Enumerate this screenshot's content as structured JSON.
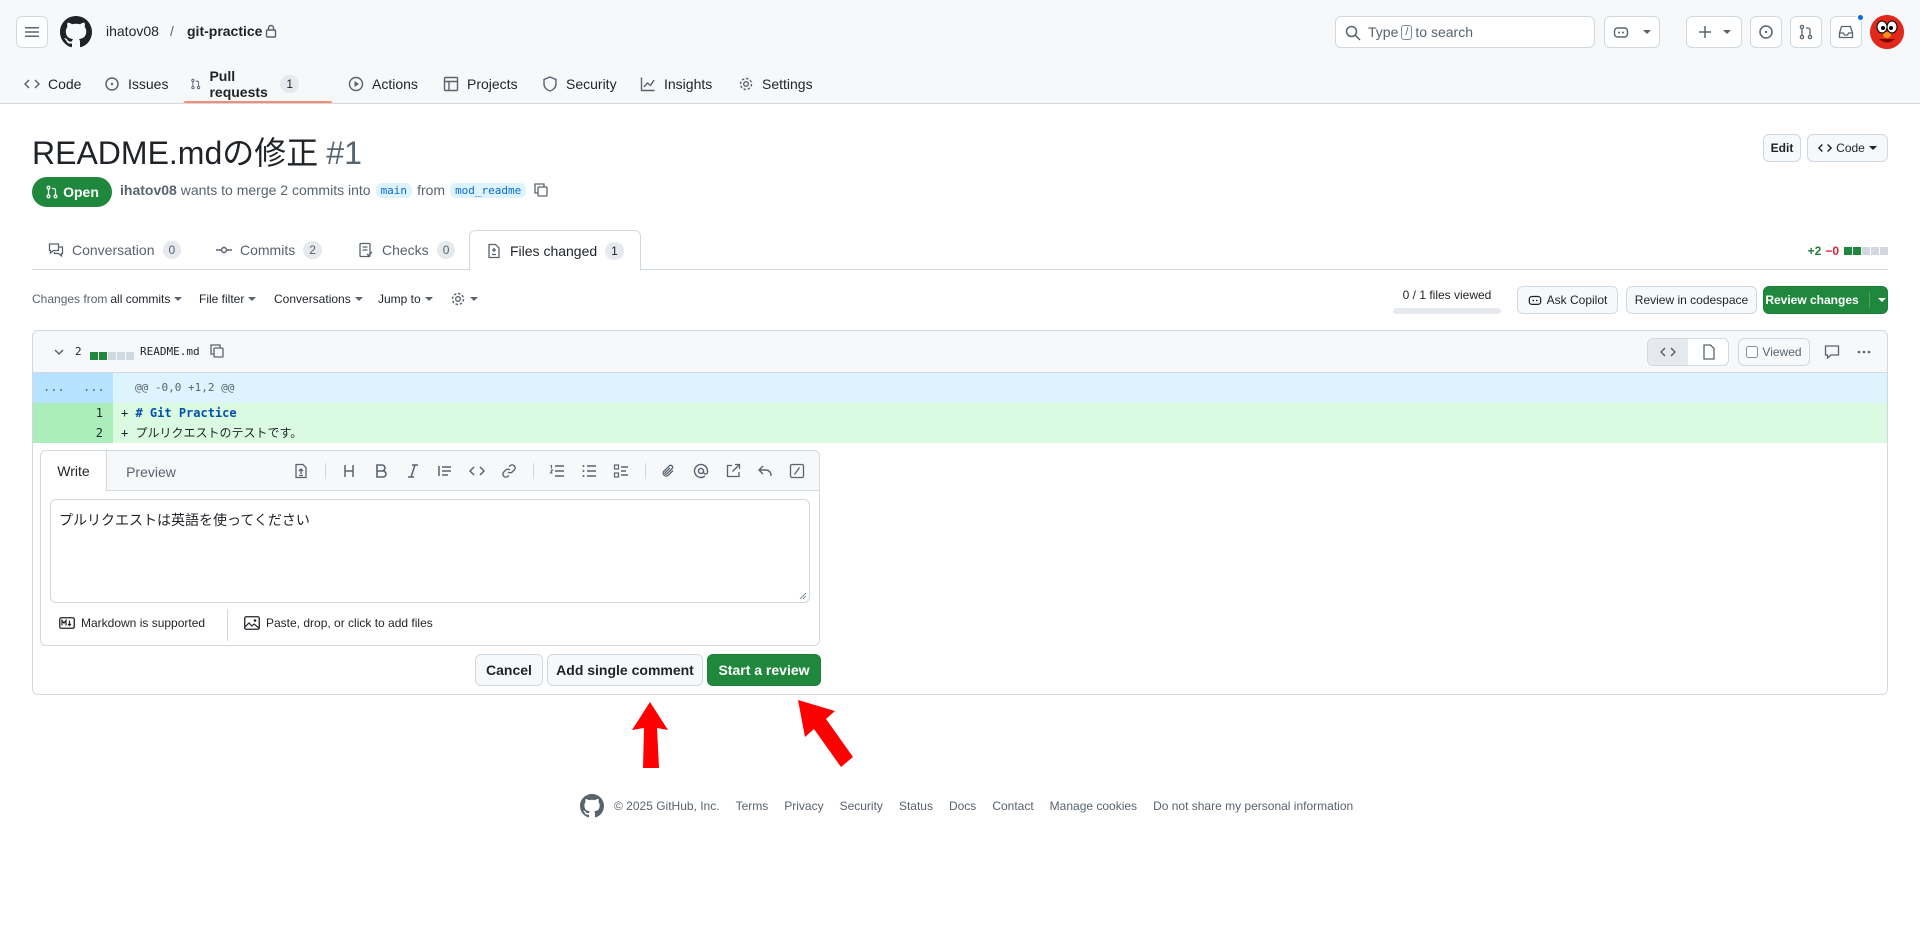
{
  "header": {
    "owner": "ihatov08",
    "separator": "/",
    "repo": "git-practice",
    "search_prefix": "Type",
    "search_key": "/",
    "search_suffix": "to search"
  },
  "repo_nav": [
    {
      "label": "Code",
      "icon": "code-icon"
    },
    {
      "label": "Issues",
      "icon": "issue-icon"
    },
    {
      "label": "Pull requests",
      "icon": "git-pull-request-icon",
      "count": "1"
    },
    {
      "label": "Actions",
      "icon": "play-icon"
    },
    {
      "label": "Projects",
      "icon": "table-icon"
    },
    {
      "label": "Security",
      "icon": "shield-icon"
    },
    {
      "label": "Insights",
      "icon": "graph-icon"
    },
    {
      "label": "Settings",
      "icon": "gear-icon"
    }
  ],
  "pr": {
    "title": "README.mdの修正",
    "number": "#1",
    "state": "Open",
    "author": "ihatov08",
    "merge_text_1": "wants to merge 2 commits into",
    "base": "main",
    "merge_text_2": "from",
    "head": "mod_readme",
    "edit_label": "Edit",
    "code_label": "Code"
  },
  "tabs": [
    {
      "label": "Conversation",
      "count": "0",
      "icon": "comment-discussion-icon"
    },
    {
      "label": "Commits",
      "count": "2",
      "icon": "git-commit-icon"
    },
    {
      "label": "Checks",
      "count": "0",
      "icon": "checklist-icon"
    },
    {
      "label": "Files changed",
      "count": "1",
      "icon": "file-diff-icon"
    }
  ],
  "diffstat": {
    "additions": "+2",
    "deletions": "−0"
  },
  "toolbar": {
    "changes_from_prefix": "Changes from",
    "changes_from_value": "all commits",
    "file_filter": "File filter",
    "conversations": "Conversations",
    "jump_to": "Jump to",
    "files_viewed": "0 / 1 files viewed",
    "ask_copilot": "Ask Copilot",
    "review_codespace": "Review in codespace",
    "review_changes": "Review changes"
  },
  "file": {
    "changes": "2",
    "name": "README.md",
    "viewed_label": "Viewed",
    "hunk_left": "...",
    "hunk_right": "...",
    "hunk_header": "@@ -0,0 +1,2 @@",
    "lines": [
      {
        "num": "1",
        "marker": "+",
        "text": "# Git Practice"
      },
      {
        "num": "2",
        "marker": "+",
        "text": "プルリクエストのテストです。"
      }
    ]
  },
  "comment": {
    "write_tab": "Write",
    "preview_tab": "Preview",
    "body": "プルリクエストは英語を使ってください",
    "markdown_note": "Markdown is supported",
    "attach_note": "Paste, drop, or click to add files",
    "cancel": "Cancel",
    "add_single": "Add single comment",
    "start_review": "Start a review"
  },
  "footer": {
    "copyright": "© 2025 GitHub, Inc.",
    "links": [
      "Terms",
      "Privacy",
      "Security",
      "Status",
      "Docs",
      "Contact",
      "Manage cookies",
      "Do not share my personal information"
    ]
  },
  "colors": {
    "accent_green": "#1f883d",
    "annotation_red": "#ff0000",
    "nav_underline": "#fd8c73"
  }
}
